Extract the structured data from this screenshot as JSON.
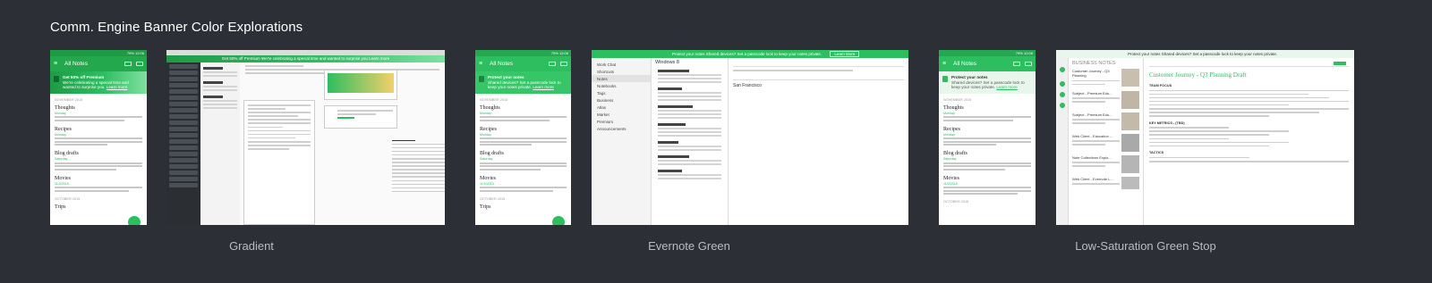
{
  "board": {
    "title": "Comm. Engine Banner Color Explorations"
  },
  "groups": [
    {
      "label": "Gradient"
    },
    {
      "label": "Evernote Green"
    },
    {
      "label": "Low-Saturation Green Stop"
    }
  ],
  "colors": {
    "evernote_green": "#2dbe60",
    "dark_green": "#1f9a45",
    "low_sat_green": "#e9f6ec",
    "background": "#2c2f36"
  },
  "phone": {
    "status_text": "79% 12:06",
    "title": "All Notes",
    "month_1": "NOVEMBER 2015",
    "month_2": "OCTOBER 2015",
    "notes": [
      {
        "title": "Thoughts",
        "date": "Monday"
      },
      {
        "title": "Recipes",
        "date": "Monday"
      },
      {
        "title": "Blog drafts",
        "date": "Saturday"
      },
      {
        "title": "Movies",
        "date": "11/3/2015"
      },
      {
        "title": "Trips",
        "date": ""
      }
    ],
    "gradient_banner": {
      "headline": "Get 50% off Premium",
      "body": "We're celebrating a special time and wanted to surprise you.",
      "link": "Learn more"
    },
    "protect_banner": {
      "headline": "Protect your notes",
      "body": "Shared devices? Set a passcode lock to keep your notes private.",
      "link": "Learn more"
    }
  },
  "desktop": {
    "gradient_banner_text": "Get 50% off Premium  We're celebrating a special time and wanted to surprise you  Learn more",
    "protect_banner_text": "Protect your notes  Shared devices? Set a passcode lock to keep your notes private.",
    "learn_more": "Learn More",
    "windows_title": "Windows 8",
    "search_text": "San Francisco",
    "sidebar_items": [
      "Work Chat",
      "Shortcuts",
      "Notes",
      "Notebooks",
      "Tags",
      "Business",
      "Atlas",
      "Market",
      "Premium",
      "Announcements"
    ],
    "business_notes_title": "BUSINESS NOTES",
    "note_title": "Customer Journey - Q3 Planning Draft",
    "note_list": [
      "Customer Journey - Q3 Planning",
      "Subject - Premium Edu...",
      "Subject - Premium Edu...",
      "Web Client - Education ...",
      "Note Collections Explo...",
      "Web Client - Evernote L..."
    ],
    "sections": [
      "TEAM FOCUS",
      "KEY METRICS - (TBD)",
      "TACTICS"
    ]
  }
}
